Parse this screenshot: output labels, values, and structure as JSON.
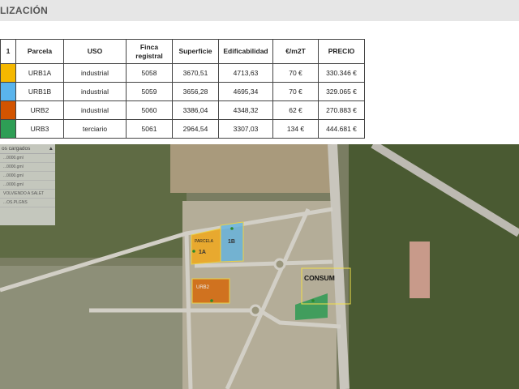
{
  "page": {
    "title": "LIZACIÓN"
  },
  "table": {
    "headers": [
      "1",
      "Parcela",
      "USO",
      "Finca registral",
      "Superficie",
      "Edificabilidad",
      "€/m2T",
      "PRECIO"
    ],
    "rows": [
      {
        "color": "#f5b800",
        "parcela": "URB1A",
        "uso": "industrial",
        "finca": "5058",
        "superficie": "3670,51",
        "edificabilidad": "4713,63",
        "eur_m2t": "70 €",
        "precio": "330.346 €"
      },
      {
        "color": "#5ab4ec",
        "parcela": "URB1B",
        "uso": "industrial",
        "finca": "5059",
        "superficie": "3656,28",
        "edificabilidad": "4695,34",
        "eur_m2t": "70 €",
        "precio": "329.065 €"
      },
      {
        "color": "#d35400",
        "parcela": "URB2",
        "uso": "industrial",
        "finca": "5060",
        "superficie": "3386,04",
        "edificabilidad": "4348,32",
        "eur_m2t": "62 €",
        "precio": "270.883 €"
      },
      {
        "color": "#2e9e55",
        "parcela": "URB3",
        "uso": "terciario",
        "finca": "5061",
        "superficie": "2964,54",
        "edificabilidad": "3307,03",
        "eur_m2t": "134 €",
        "precio": "444.681 €"
      }
    ]
  },
  "layers_panel": {
    "title": "os cargados",
    "items": [
      "...0000.gml",
      "...0000.gml",
      "...0000.gml",
      "...0000.gml",
      "VOLVIENDO A SALET",
      "...OS.PLGNS"
    ]
  },
  "map": {
    "labels": {
      "urb1a": "1A",
      "urb1b": "1B",
      "urb2": "URB2",
      "consum": "CONSUM",
      "parcela": "PARCELA"
    }
  }
}
